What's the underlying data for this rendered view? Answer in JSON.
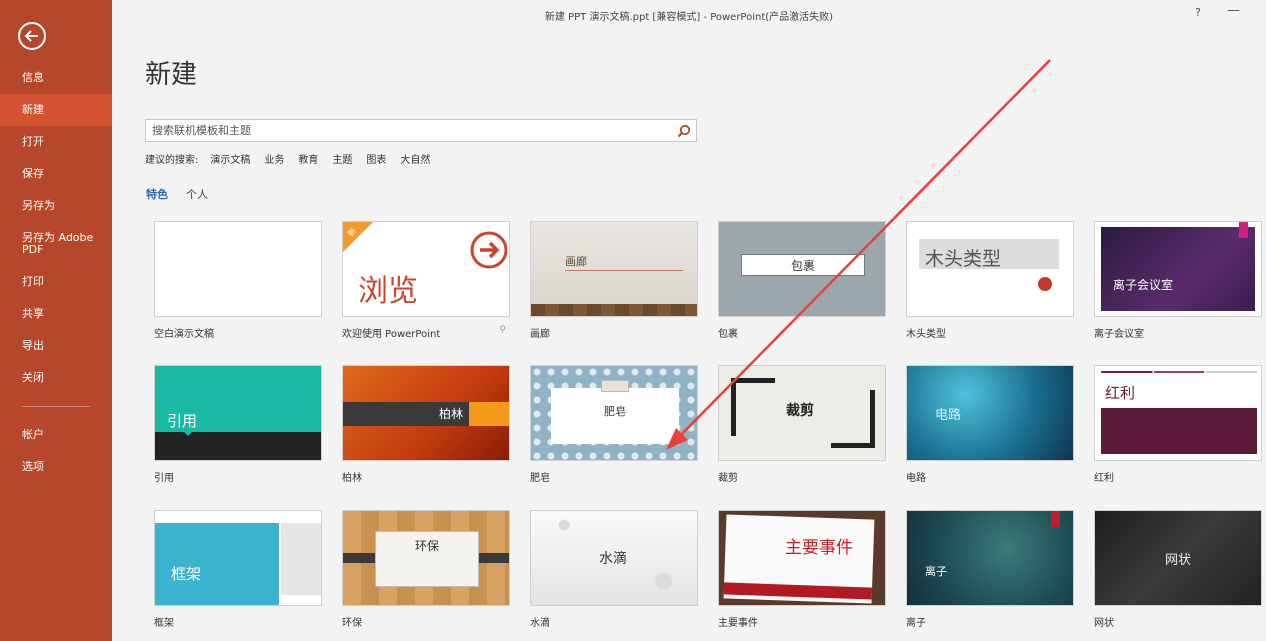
{
  "window_title": "新建 PPT 演示文稿.ppt [兼容模式] - PowerPoint(产品激活失败)",
  "title_controls": {
    "help": "?",
    "minimize": "—"
  },
  "sidebar": {
    "items": [
      {
        "label": "信息"
      },
      {
        "label": "新建"
      },
      {
        "label": "打开"
      },
      {
        "label": "保存"
      },
      {
        "label": "另存为"
      },
      {
        "label": "另存为 Adobe PDF"
      },
      {
        "label": "打印"
      },
      {
        "label": "共享"
      },
      {
        "label": "导出"
      },
      {
        "label": "关闭"
      },
      {
        "label": "帐户"
      },
      {
        "label": "选项"
      }
    ],
    "active_index": 1
  },
  "main": {
    "title": "新建",
    "search": {
      "placeholder": "搜索联机模板和主题"
    },
    "suggested": {
      "label": "建议的搜索:",
      "items": [
        "演示文稿",
        "业务",
        "教育",
        "主题",
        "图表",
        "大自然"
      ]
    },
    "tabs": [
      {
        "label": "特色",
        "active": true
      },
      {
        "label": "个人",
        "active": false
      }
    ]
  },
  "templates": [
    {
      "label": "空白演示文稿",
      "thumb_text": ""
    },
    {
      "label": "欢迎使用 PowerPoint",
      "thumb_text": "浏览",
      "badge": "新"
    },
    {
      "label": "画廊",
      "thumb_text": "画廊"
    },
    {
      "label": "包裹",
      "thumb_text": "包裹"
    },
    {
      "label": "木头类型",
      "thumb_text": "木头类型"
    },
    {
      "label": "离子会议室",
      "thumb_text": "离子会议室"
    },
    {
      "label": "引用",
      "thumb_text": "引用"
    },
    {
      "label": "柏林",
      "thumb_text": "柏林"
    },
    {
      "label": "肥皂",
      "thumb_text": "肥皂"
    },
    {
      "label": "裁剪",
      "thumb_text": "裁剪"
    },
    {
      "label": "电路",
      "thumb_text": "电路"
    },
    {
      "label": "红利",
      "thumb_text": "红利"
    },
    {
      "label": "框架",
      "thumb_text": "框架"
    },
    {
      "label": "环保",
      "thumb_text": "环保"
    },
    {
      "label": "水滴",
      "thumb_text": "水滴"
    },
    {
      "label": "主要事件",
      "thumb_text": "主要事件"
    },
    {
      "label": "离子",
      "thumb_text": "离子"
    },
    {
      "label": "网状",
      "thumb_text": "网状"
    }
  ],
  "colors": {
    "sidebar": "#b7472a",
    "sidebar_active": "#d35230",
    "accent_blue": "#2b6cb0",
    "annotation_arrow": "#e8413a"
  }
}
